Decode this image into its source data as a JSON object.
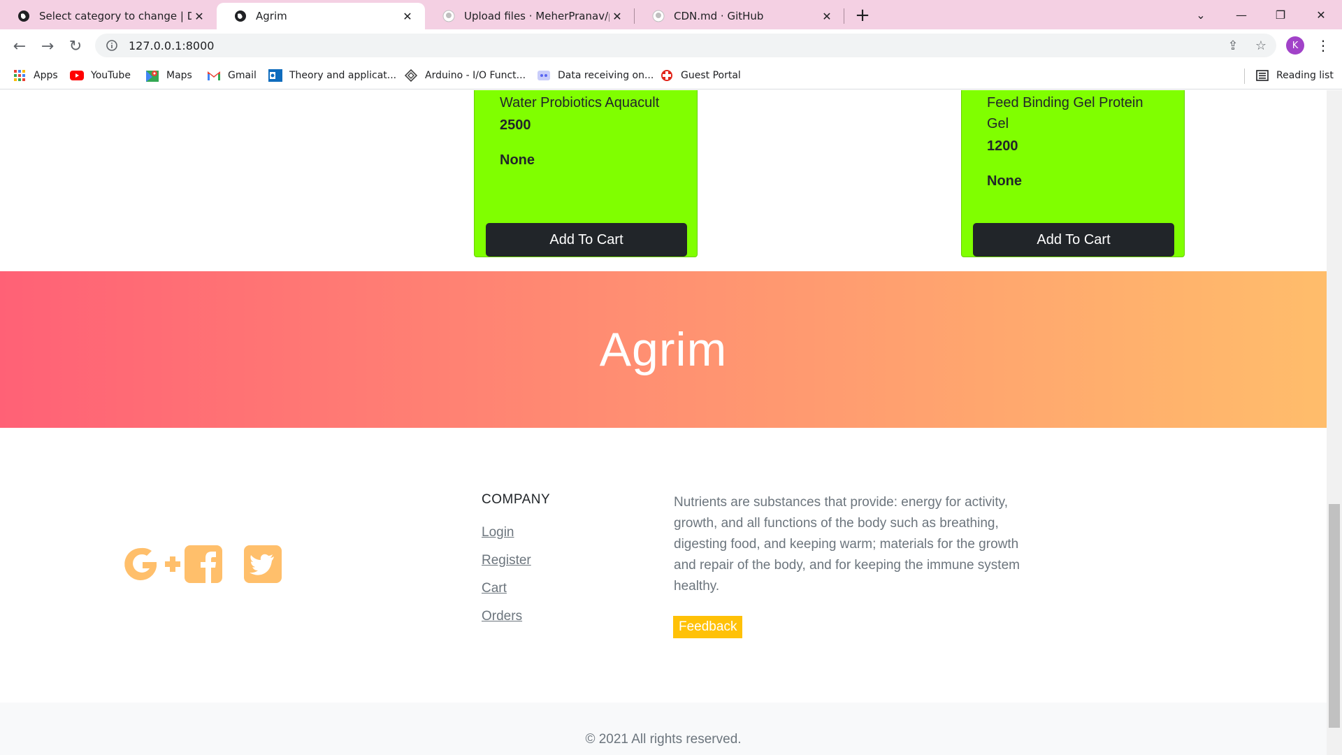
{
  "browser": {
    "tabs": [
      {
        "title": "Select category to change | Djang",
        "active": false,
        "icon": "globe-icon"
      },
      {
        "title": "Agrim",
        "active": true,
        "icon": "globe-icon"
      },
      {
        "title": "Upload files · MeherPranav/pfsd",
        "active": false,
        "icon": "github-icon"
      },
      {
        "title": "CDN.md · GitHub",
        "active": false,
        "icon": "github-icon"
      }
    ],
    "url": "127.0.0.1:8000",
    "profile_initial": "K",
    "bookmarks": [
      {
        "label": "Apps",
        "icon": "apps-grid-icon"
      },
      {
        "label": "YouTube",
        "icon": "youtube-icon"
      },
      {
        "label": "Maps",
        "icon": "maps-icon"
      },
      {
        "label": "Gmail",
        "icon": "gmail-icon"
      },
      {
        "label": "Theory and applicat...",
        "icon": "outlook-icon"
      },
      {
        "label": "Arduino - I/O Funct...",
        "icon": "arduino-icon"
      },
      {
        "label": "Data receiving on...",
        "icon": "discord-icon"
      },
      {
        "label": "Guest Portal",
        "icon": "portal-icon"
      }
    ],
    "reading_list": "Reading list"
  },
  "products": [
    {
      "name": "Water Probiotics Aquacult",
      "price": "2500",
      "extra": "None",
      "button": "Add To Cart"
    },
    {
      "name": "Feed Binding Gel Protein Gel",
      "price": "1200",
      "extra": "None",
      "button": "Add To Cart"
    }
  ],
  "hero": {
    "brand": "Agrim"
  },
  "footer": {
    "social_icons": [
      "google-plus-icon",
      "facebook-icon",
      "twitter-icon"
    ],
    "company_title": "COMPANY",
    "links": [
      "Login",
      "Register",
      "Cart",
      "Orders"
    ],
    "about": "Nutrients are substances that provide: energy for activity, growth, and all functions of the body such as breathing, digesting food, and keeping warm; materials for the growth and repair of the body, and for keeping the immune system healthy.",
    "feedback_label": "Feedback",
    "copyright": "© 2021 All rights reserved."
  },
  "colors": {
    "tabbar": "#f4d0e3",
    "product_card": "#80ff00",
    "button_dark": "#212529",
    "hero_start": "#ff6176",
    "hero_end": "#ffbd6b",
    "social": "#ffbf6b",
    "feedback": "#ffc107"
  }
}
